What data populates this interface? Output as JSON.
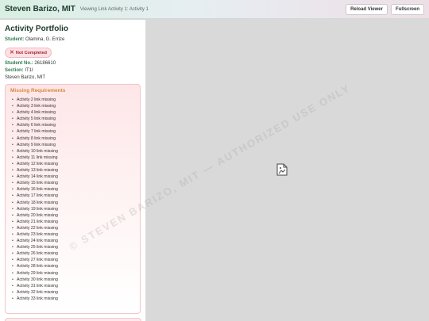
{
  "header": {
    "name": "Steven Barizo, MIT",
    "viewing": "Viewing Link Activity 1: Activity 1",
    "reload_label": "Reload Viewer",
    "fullscreen_label": "Fullscreen"
  },
  "sidebar": {
    "title": "Activity Portfolio",
    "student_key": "Student:",
    "student_value": "Olamina, G. Errize",
    "status": "Not Completed",
    "student_no_key": "Student No.:",
    "student_no_value": "26186610",
    "section_key": "Section:",
    "section_value": "IT1I",
    "instructor": "Steven Barizo, MIT"
  },
  "requirements": {
    "title": "Missing Requirements",
    "items": [
      "Activity 2 link missing",
      "Activity 3 link missing",
      "Activity 4 link missing",
      "Activity 5 link missing",
      "Activity 6 link missing",
      "Activity 7 link missing",
      "Activity 8 link missing",
      "Activity 9 link missing",
      "Activity 10 link missing",
      "Activity 11 link missing",
      "Activity 12 link missing",
      "Activity 13 link missing",
      "Activity 14 link missing",
      "Activity 15 link missing",
      "Activity 16 link missing",
      "Activity 17 link missing",
      "Activity 18 link missing",
      "Activity 19 link missing",
      "Activity 20 link missing",
      "Activity 21 link missing",
      "Activity 22 link missing",
      "Activity 23 link missing",
      "Activity 24 link missing",
      "Activity 25 link missing",
      "Activity 26 link missing",
      "Activity 27 link missing",
      "Activity 28 link missing",
      "Activity 29 link missing",
      "Activity 30 link missing",
      "Activity 31 link missing",
      "Activity 32 link missing",
      "Activity 33 link missing"
    ]
  },
  "watermark": "© STEVEN BARIZO, MIT — AUTHORIZED USE ONLY",
  "viewer": {
    "icon": "broken-document-icon"
  },
  "colors": {
    "accent_green": "#2e7d4f",
    "status_red": "#a12a36",
    "requirements_orange": "#d7883a",
    "viewer_bg": "#d9d9d9"
  }
}
